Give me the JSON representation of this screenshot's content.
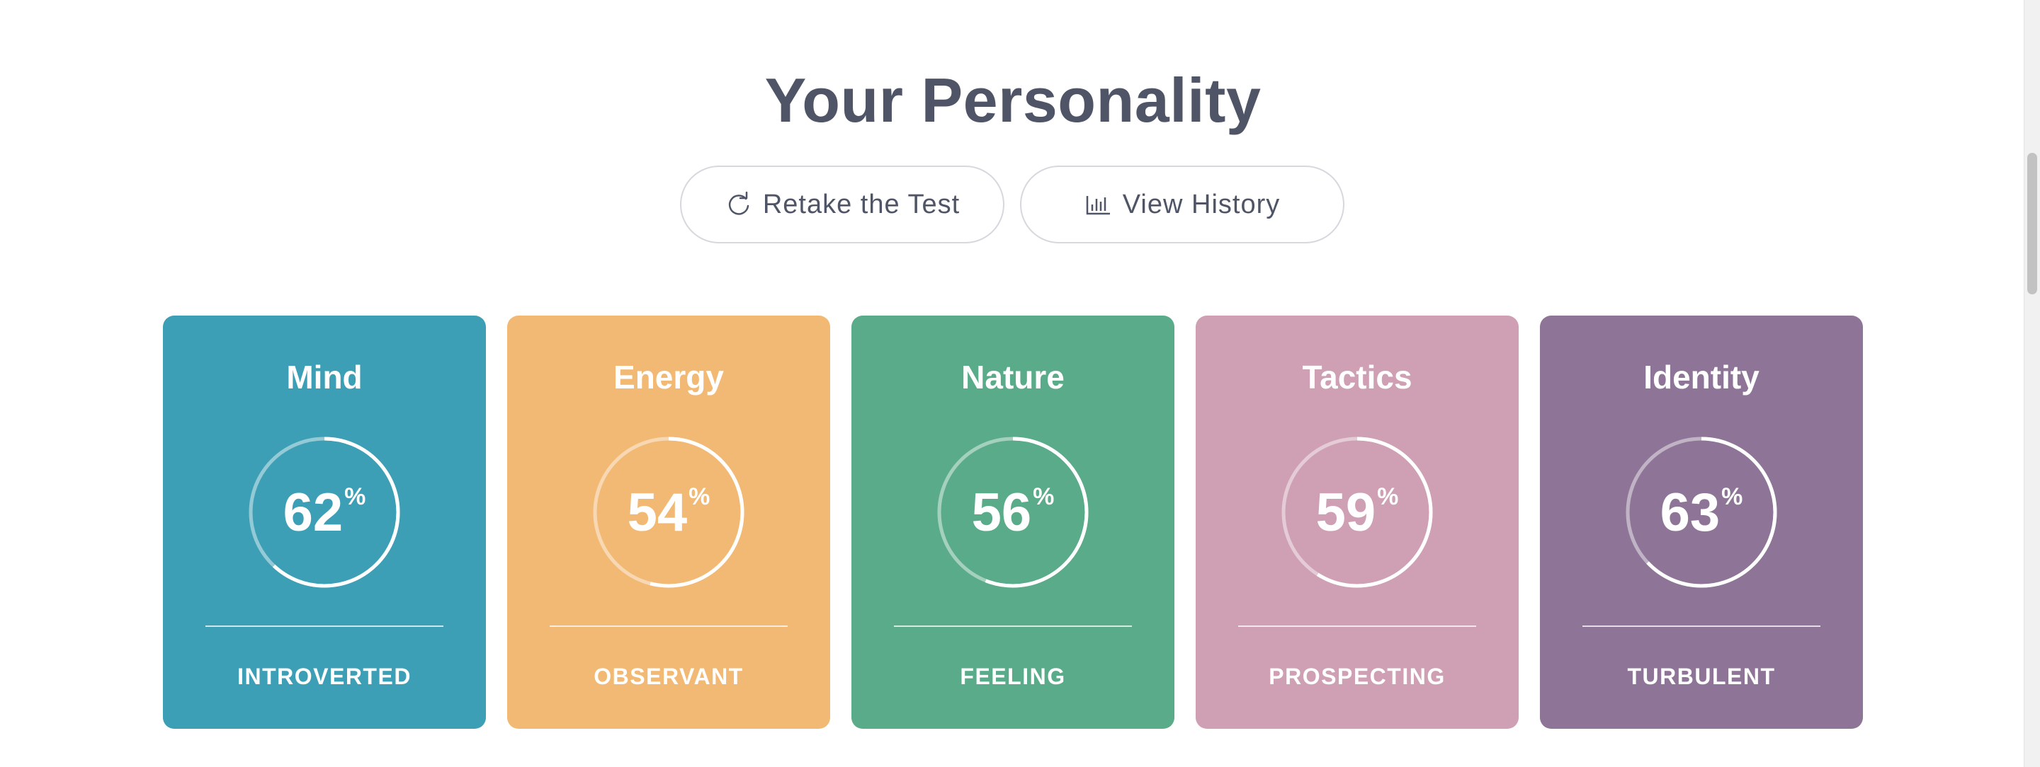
{
  "header": {
    "title": "Your Personality"
  },
  "actions": {
    "retake_label": "Retake the Test",
    "history_label": "View History"
  },
  "cards": [
    {
      "title": "Mind",
      "percent": 62,
      "trait": "INTROVERTED",
      "color": "#3d9fb5"
    },
    {
      "title": "Energy",
      "percent": 54,
      "trait": "OBSERVANT",
      "color": "#f2b974"
    },
    {
      "title": "Nature",
      "percent": 56,
      "trait": "FEELING",
      "color": "#5aab89"
    },
    {
      "title": "Tactics",
      "percent": 59,
      "trait": "PROSPECTING",
      "color": "#cfa0b4"
    },
    {
      "title": "Identity",
      "percent": 63,
      "trait": "TURBULENT",
      "color": "#8e7598"
    }
  ],
  "percent_symbol": "%",
  "icons": {
    "retake": "refresh-icon",
    "history": "bar-chart-icon"
  }
}
